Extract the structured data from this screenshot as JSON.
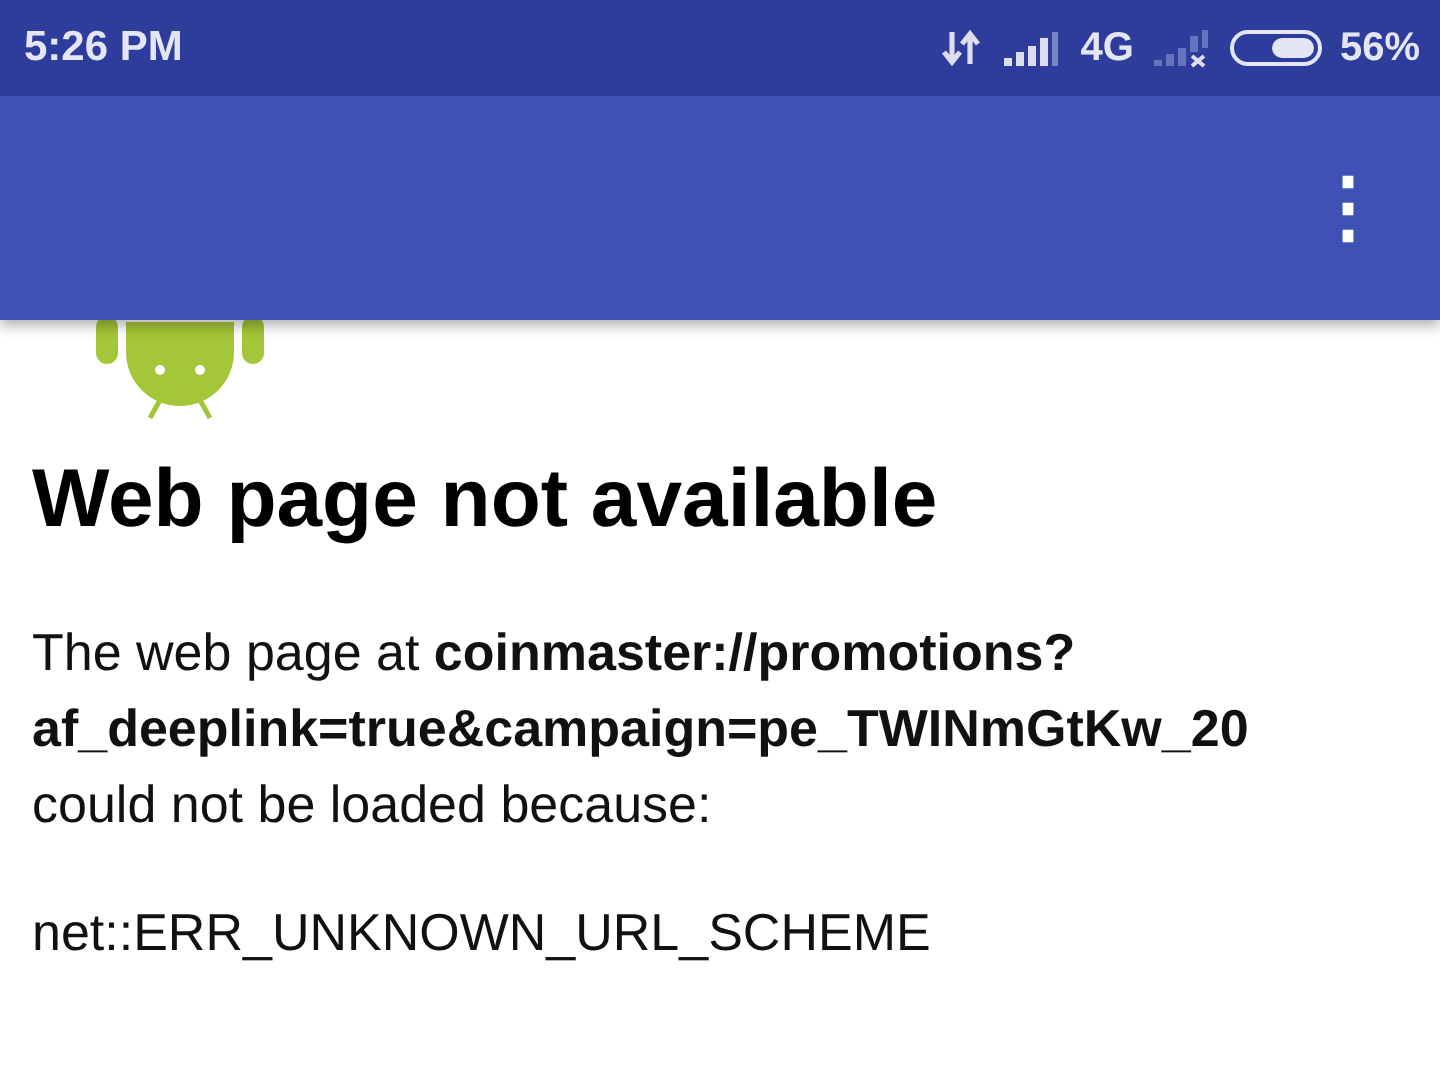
{
  "status_bar": {
    "time": "5:26 PM",
    "network": "4G",
    "battery": "56%",
    "battery_icon": {
      "level": 0.56
    }
  },
  "app_bar": {
    "menu": "⋮"
  },
  "error": {
    "title": "Web page not available",
    "message": "The web page at **coinmaster://promotions?af_deeplink=true&campaign=pe_TWINmGtKw_20** could not be loaded because:",
    "code": "net::ERR_UNKNOWN_URL_SCHEME"
  }
}
